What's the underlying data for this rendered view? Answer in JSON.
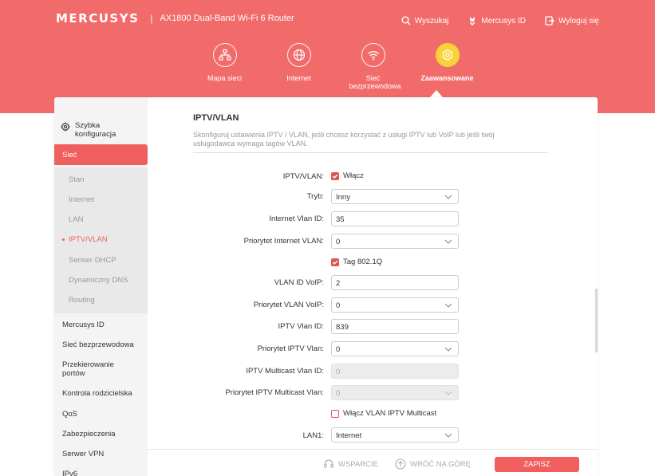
{
  "header": {
    "logo": "MERCUSYS",
    "separator": "|",
    "model": "AX1800 Dual-Band Wi-Fi 6 Router",
    "actions": {
      "search": "Wyszukaj",
      "mercusys_id": "Mercusys ID",
      "logout": "Wyloguj się"
    }
  },
  "nav": {
    "network_map": "Mapa sieci",
    "internet": "Internet",
    "wireless": "Sieć bezprzewodowa",
    "advanced": "Zaawansowane",
    "active": "advanced"
  },
  "sidebar": {
    "quick_setup": "Szybka konfiguracja",
    "network": "Sieć",
    "sub_items": [
      "Stan",
      "Internet",
      "LAN",
      "IPTV/VLAN",
      "Serwer DHCP",
      "Dynamiczny DNS",
      "Routing"
    ],
    "active_sub": "IPTV/VLAN",
    "main_items": [
      "Mercusys ID",
      "Sieć bezprzewodowa",
      "Przekierowanie portów",
      "Kontrola rodzicielska",
      "QoS",
      "Zabezpieczenia",
      "Serwer VPN",
      "IPv6"
    ]
  },
  "content": {
    "title": "IPTV/VLAN",
    "description": "Skonfiguruj ustawienia IPTV / VLAN, jeśli chcesz korzystać z usługi IPTV lub VoIP lub jeśli twój usługodawca wymaga tagów VLAN.",
    "iptv_vlan": {
      "label": "IPTV/VLAN:",
      "check_label": "Włącz",
      "checked": true
    },
    "mode": {
      "label": "Tryb:",
      "value": "Inny"
    },
    "internet_vlan_id": {
      "label": "Internet Vlan ID:",
      "value": "35"
    },
    "internet_vlan_priority": {
      "label": "Priorytet Internet VLAN:",
      "value": "0"
    },
    "tag_8021q": {
      "label": "Tag 802.1Q",
      "checked": true
    },
    "voip_vlan_id": {
      "label": "VLAN ID VoIP:",
      "value": "2"
    },
    "voip_vlan_priority": {
      "label": "Priorytet VLAN VoIP:",
      "value": "0"
    },
    "iptv_vlan_id": {
      "label": "IPTV Vlan ID:",
      "value": "839"
    },
    "iptv_vlan_priority": {
      "label": "Priorytet IPTV Vlan:",
      "value": "0"
    },
    "iptv_multicast_vlan_id": {
      "label": "IPTV Multicast Vlan ID:",
      "value": "0",
      "disabled": true
    },
    "iptv_multicast_vlan_priority": {
      "label": "Priorytet IPTV Multicast Vlan:",
      "value": "0",
      "disabled": true
    },
    "enable_multicast_vlan": {
      "label": "Włącz VLAN IPTV Multicast",
      "checked": false
    },
    "lan1": {
      "label": "LAN1:",
      "value": "Internet"
    }
  },
  "footer": {
    "support": "WSPARCIE",
    "back_to_top": "WRÓĆ NA GÓRĘ",
    "save": "ZAPISZ"
  },
  "colors": {
    "accent": "#f26b6b",
    "active_nav": "#f8d23b",
    "checkbox": "#e05454"
  }
}
